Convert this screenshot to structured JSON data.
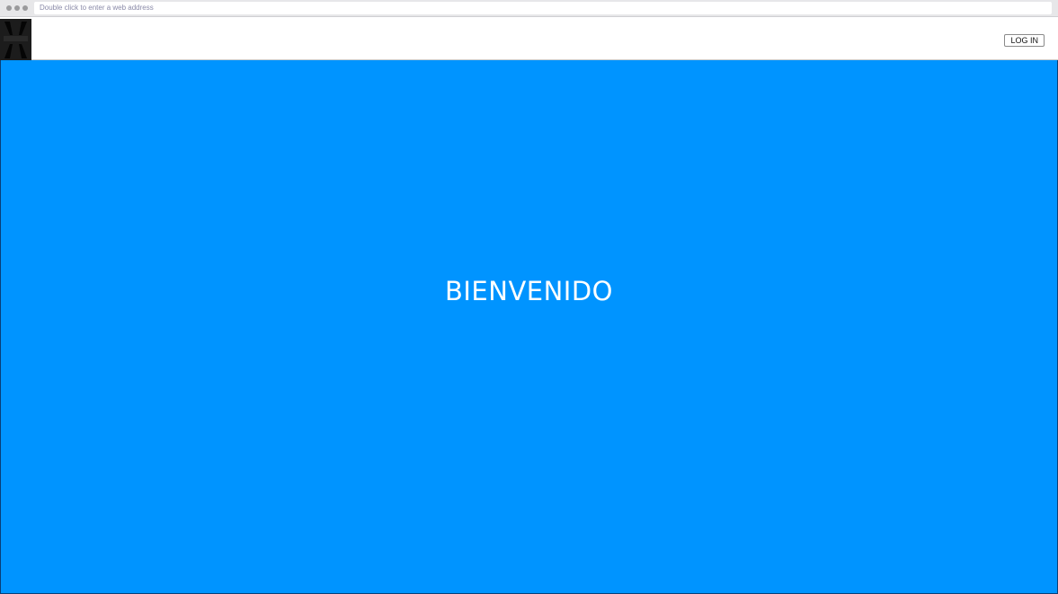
{
  "browser": {
    "address_placeholder": "Double click to enter a web address"
  },
  "header": {
    "logo_icon": "brand-logo-icon",
    "login_label": "LOG IN"
  },
  "hero": {
    "title": "BIENVENIDO",
    "background_color": "#0094ff",
    "text_color": "#ffffff"
  }
}
